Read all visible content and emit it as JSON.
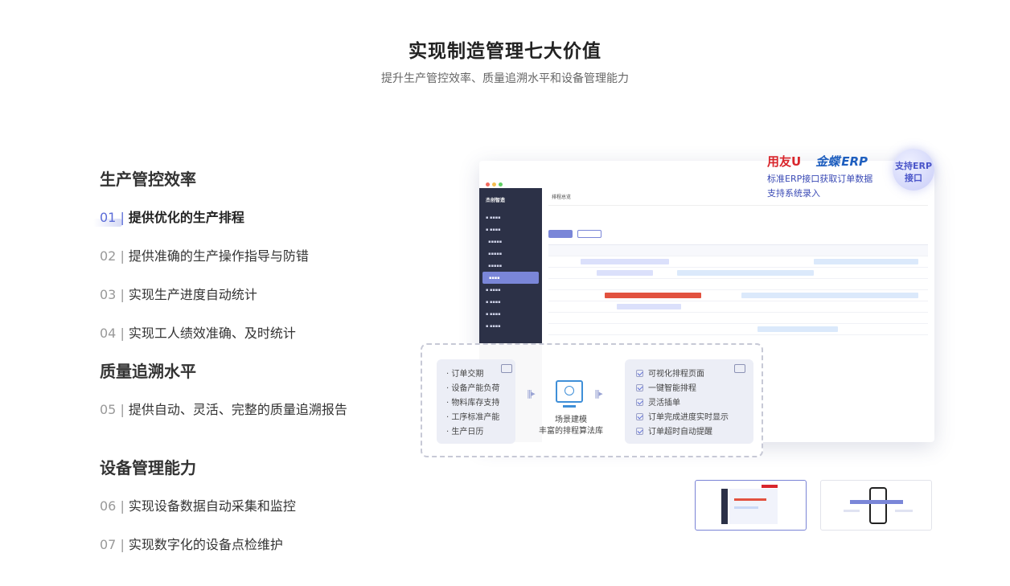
{
  "header": {
    "title": "实现制造管理七大价值",
    "subtitle": "提升生产管控效率、质量追溯水平和设备管理能力"
  },
  "groups": [
    {
      "title": "生产管控效率"
    },
    {
      "title": "质量追溯水平"
    },
    {
      "title": "设备管理能力"
    }
  ],
  "items": [
    {
      "num": "01 | ",
      "label": "提供优化的生产排程",
      "active": true
    },
    {
      "num": "02 | ",
      "label": "提供准确的生产操作指导与防错"
    },
    {
      "num": "03 | ",
      "label": "实现生产进度自动统计"
    },
    {
      "num": "04 | ",
      "label": "实现工人绩效准确、及时统计"
    },
    {
      "num": "05 | ",
      "label": "提供自动、灵活、完整的质量追溯报告"
    },
    {
      "num": "06 | ",
      "label": "实现设备数据自动采集和监控"
    },
    {
      "num": "07 | ",
      "label": "实现数字化的设备点检维护"
    }
  ],
  "showcase": {
    "badge_line1": "支持ERP",
    "badge_line2": "接口",
    "logo_yonyou": "用友",
    "logo_yonyou_mark": "U",
    "logo_kingdee": "金蝶",
    "logo_kingdee_erp": "ERP",
    "erp_line1": "标准ERP接口获取订单数据",
    "erp_line2": "支持系统录入",
    "inputs": [
      "订单交期",
      "设备产能负荷",
      "物料库存支持",
      "工序标准产能",
      "生产日历"
    ],
    "outputs": [
      "可视化排程页面",
      "一键智能排程",
      "灵活插单",
      "订单完成进度实时显示",
      "订单超时自动提醒"
    ],
    "center_line1": "场景建模",
    "center_line2": "丰富的排程算法库",
    "app_brand": "杰创智造",
    "app_crumb": "排程总览",
    "colors": {
      "accent": "#5b6cd8",
      "sidebar": "#2c3147",
      "bar_blue": "#dbe9fb",
      "bar_red": "#e2523f"
    }
  }
}
